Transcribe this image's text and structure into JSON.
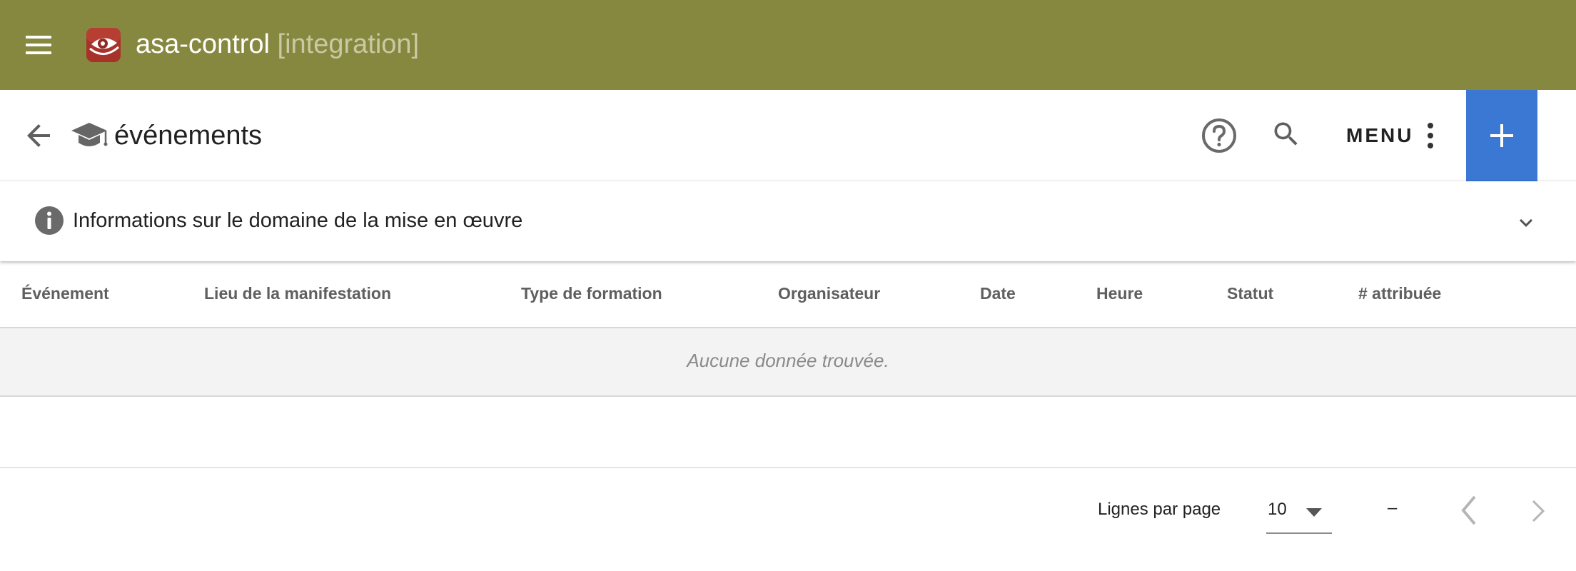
{
  "app": {
    "title": "asa-control",
    "environment": "[integration]",
    "bar_color": "#878840",
    "menu_icon": "hamburger-menu-icon",
    "logo_icon": "eye-logo-icon"
  },
  "header": {
    "title": "événements",
    "back_icon": "arrow-left-icon",
    "title_icon": "graduation-cap-icon",
    "help_icon": "help-circle-icon",
    "search_icon": "search-icon",
    "menu_label": "MENU",
    "menu_icon": "vertical-dots-icon",
    "add_icon": "plus-icon",
    "add_color": "#3a78d4"
  },
  "info_panel": {
    "label": "Informations sur le domaine de la mise en œuvre",
    "icon": "info-icon",
    "toggle_icon": "chevron-down-icon"
  },
  "table": {
    "columns": [
      "Événement",
      "Lieu de la manifestation",
      "Type de formation",
      "Organisateur",
      "Date",
      "Heure",
      "Statut",
      "# attribuée"
    ],
    "empty_message": "Aucune donnée trouvée."
  },
  "pagination": {
    "rows_per_page_label": "Lignes par page",
    "rows_per_page_value": "10",
    "range": "–",
    "prev_icon": "chevron-left-icon",
    "next_icon": "chevron-right-icon"
  }
}
